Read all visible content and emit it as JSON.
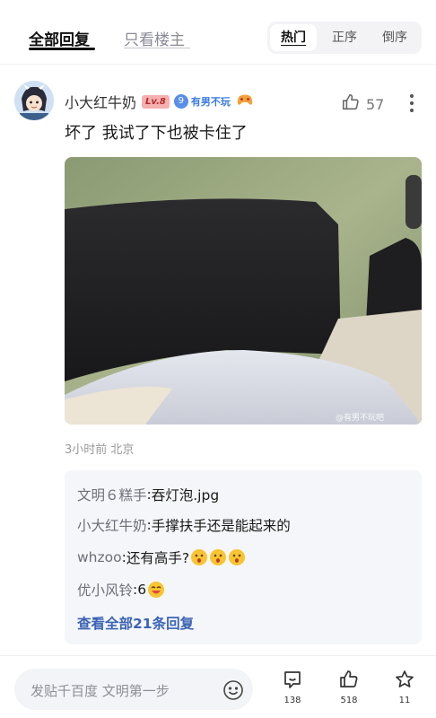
{
  "tabs": {
    "all_replies": "全部回复",
    "op_only": "只看楼主"
  },
  "sort": {
    "hot": "热门",
    "asc": "正序",
    "desc": "倒序",
    "selected": "热门"
  },
  "comment": {
    "author": "小大红牛奶",
    "level": "Lv.8",
    "fan_level": "9",
    "fan_title": "有男不玩",
    "likes": "57",
    "text": "坏了 我试了下也被卡住了",
    "image_watermark": "@有男不玩吧",
    "time": "3小时前",
    "location": "北京"
  },
  "replies": [
    {
      "name": "文明６糕手",
      "sep": ":",
      "text": "吞灯泡.jpg",
      "emojis": []
    },
    {
      "name": "小大红牛奶",
      "sep": ":",
      "text": "手撑扶手还是能起来的",
      "emojis": []
    },
    {
      "name": "whzoo",
      "sep": ":",
      "text": "还有高手?",
      "emojis": [
        "surprised-face",
        "surprised-face",
        "surprised-face"
      ]
    },
    {
      "name": "优小风铃",
      "sep": ":",
      "text": "6",
      "emojis": [
        "laughing-face"
      ]
    }
  ],
  "view_all": "查看全部21条回复",
  "bottom": {
    "placeholder": "发贴千百度 文明第一步",
    "comments": "138",
    "likes": "518",
    "favorites": "11"
  },
  "colors": {
    "accent_blue": "#3b63b5",
    "level_badge": "#f5b0b0",
    "fan_badge": "#5a8ee8"
  }
}
